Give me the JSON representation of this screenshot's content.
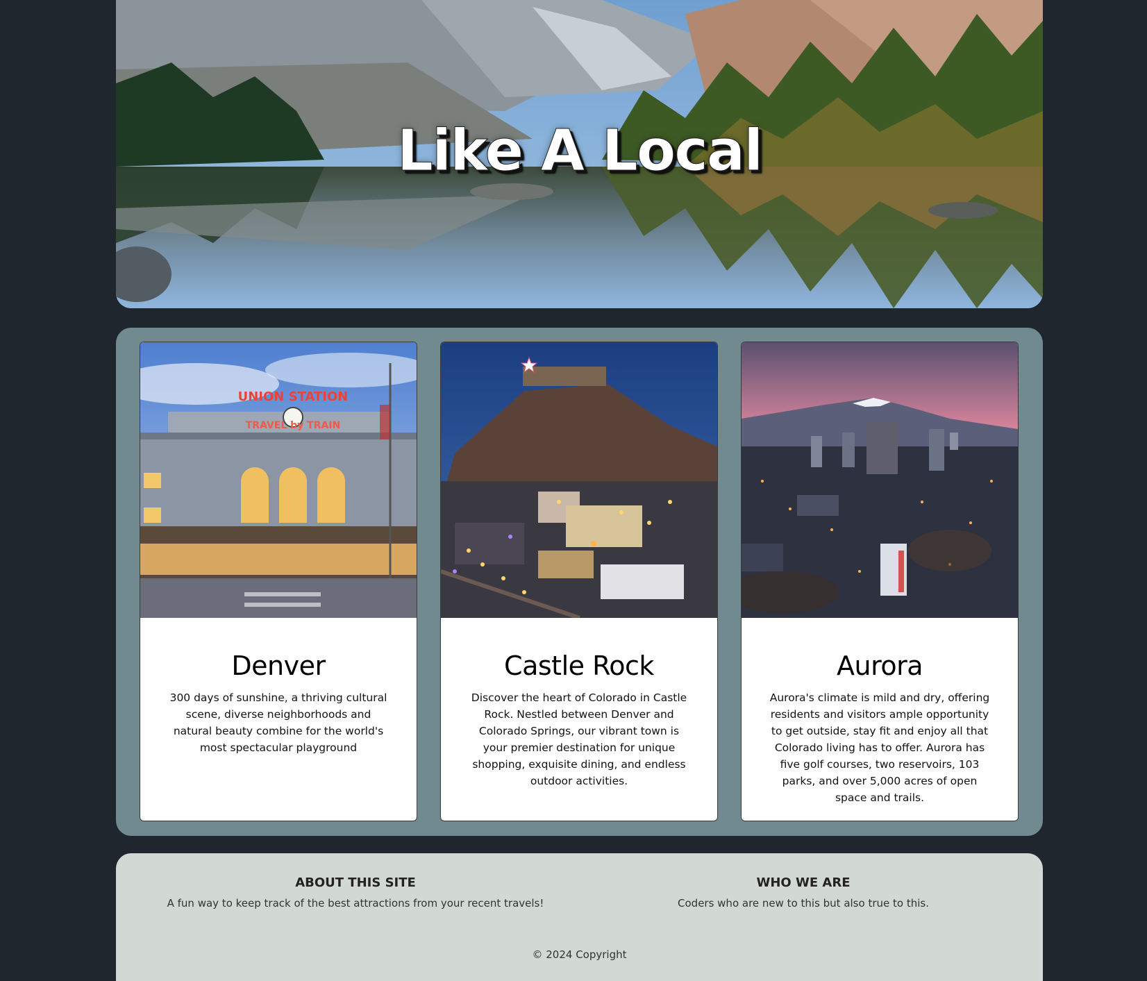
{
  "hero": {
    "title": "Like A Local"
  },
  "cards": [
    {
      "title": "Denver",
      "text": "300 days of sunshine, a thriving cultural scene, diverse neighborhoods and natural beauty combine for the world's most spectacular playground",
      "sign_top": "UNION STATION",
      "sign_bottom": "TRAVEL by TRAIN"
    },
    {
      "title": "Castle Rock",
      "text": "Discover the heart of Colorado in Castle Rock. Nestled between Denver and Colorado Springs, our vibrant town is your premier destination for unique shopping, exquisite dining, and endless outdoor activities."
    },
    {
      "title": "Aurora",
      "text": "Aurora's climate is mild and dry, offering residents and visitors ample opportunity to get outside, stay fit and enjoy all that Colorado living has to offer. Aurora has five golf courses, two reservoirs, 103 parks, and over 5,000 acres of open space and trails."
    }
  ],
  "footer": {
    "about_heading": "ABOUT THIS SITE",
    "about_text": "A fun way to keep track of the best attractions from your recent travels!",
    "who_heading": "WHO WE ARE",
    "who_text": "Coders who are new to this but also true to this.",
    "copyright": "© 2024 Copyright"
  },
  "colors": {
    "page_bg": "#20262d",
    "cards_bg": "#718a8f",
    "footer_bg": "#d2d8d3"
  }
}
